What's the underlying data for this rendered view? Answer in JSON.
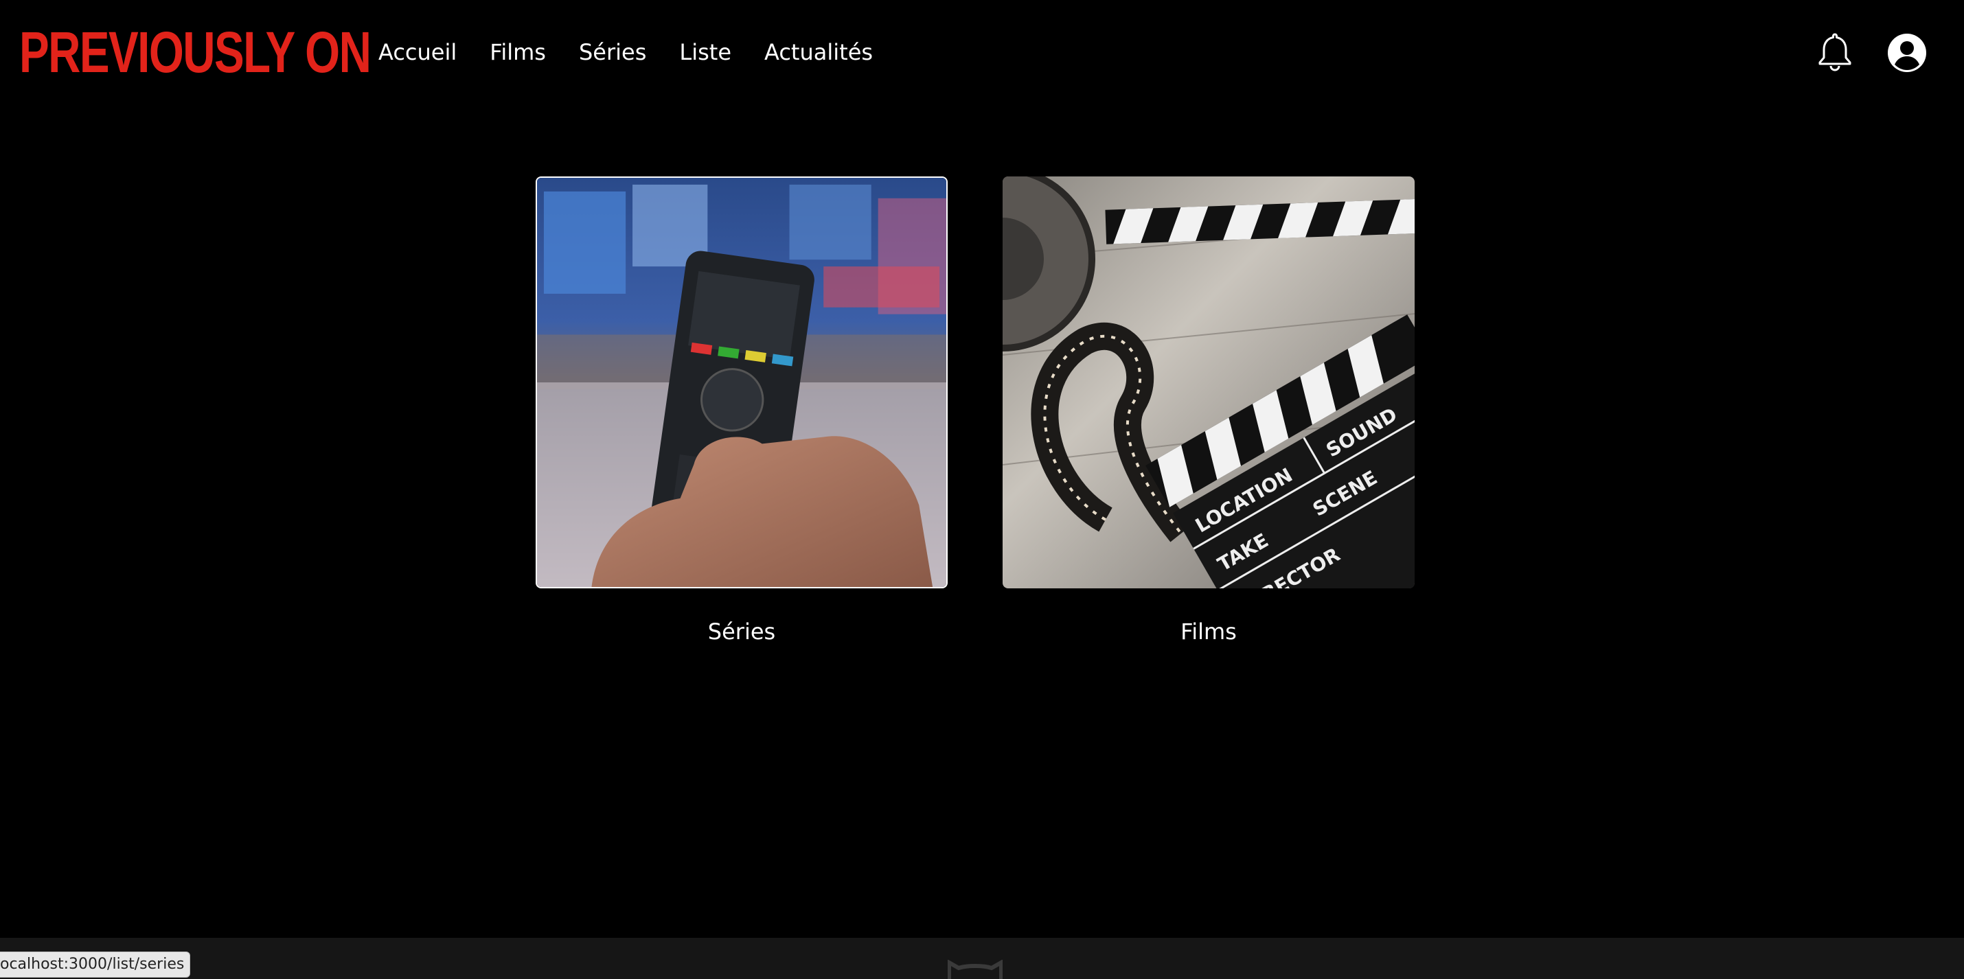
{
  "header": {
    "logo": "PREVIOUSLY ON",
    "nav": [
      {
        "label": "Accueil"
      },
      {
        "label": "Films"
      },
      {
        "label": "Séries"
      },
      {
        "label": "Liste"
      },
      {
        "label": "Actualités"
      }
    ],
    "icons": [
      "bell-icon",
      "account-icon"
    ]
  },
  "cards": [
    {
      "label": "Séries",
      "image": "tv-remote-photo"
    },
    {
      "label": "Films",
      "image": "clapperboard-photo"
    }
  ],
  "status_bar": {
    "url": "ocalhost:3000/list/series"
  },
  "colors": {
    "background": "#000000",
    "brand": "#e2231a",
    "text": "#ffffff"
  }
}
